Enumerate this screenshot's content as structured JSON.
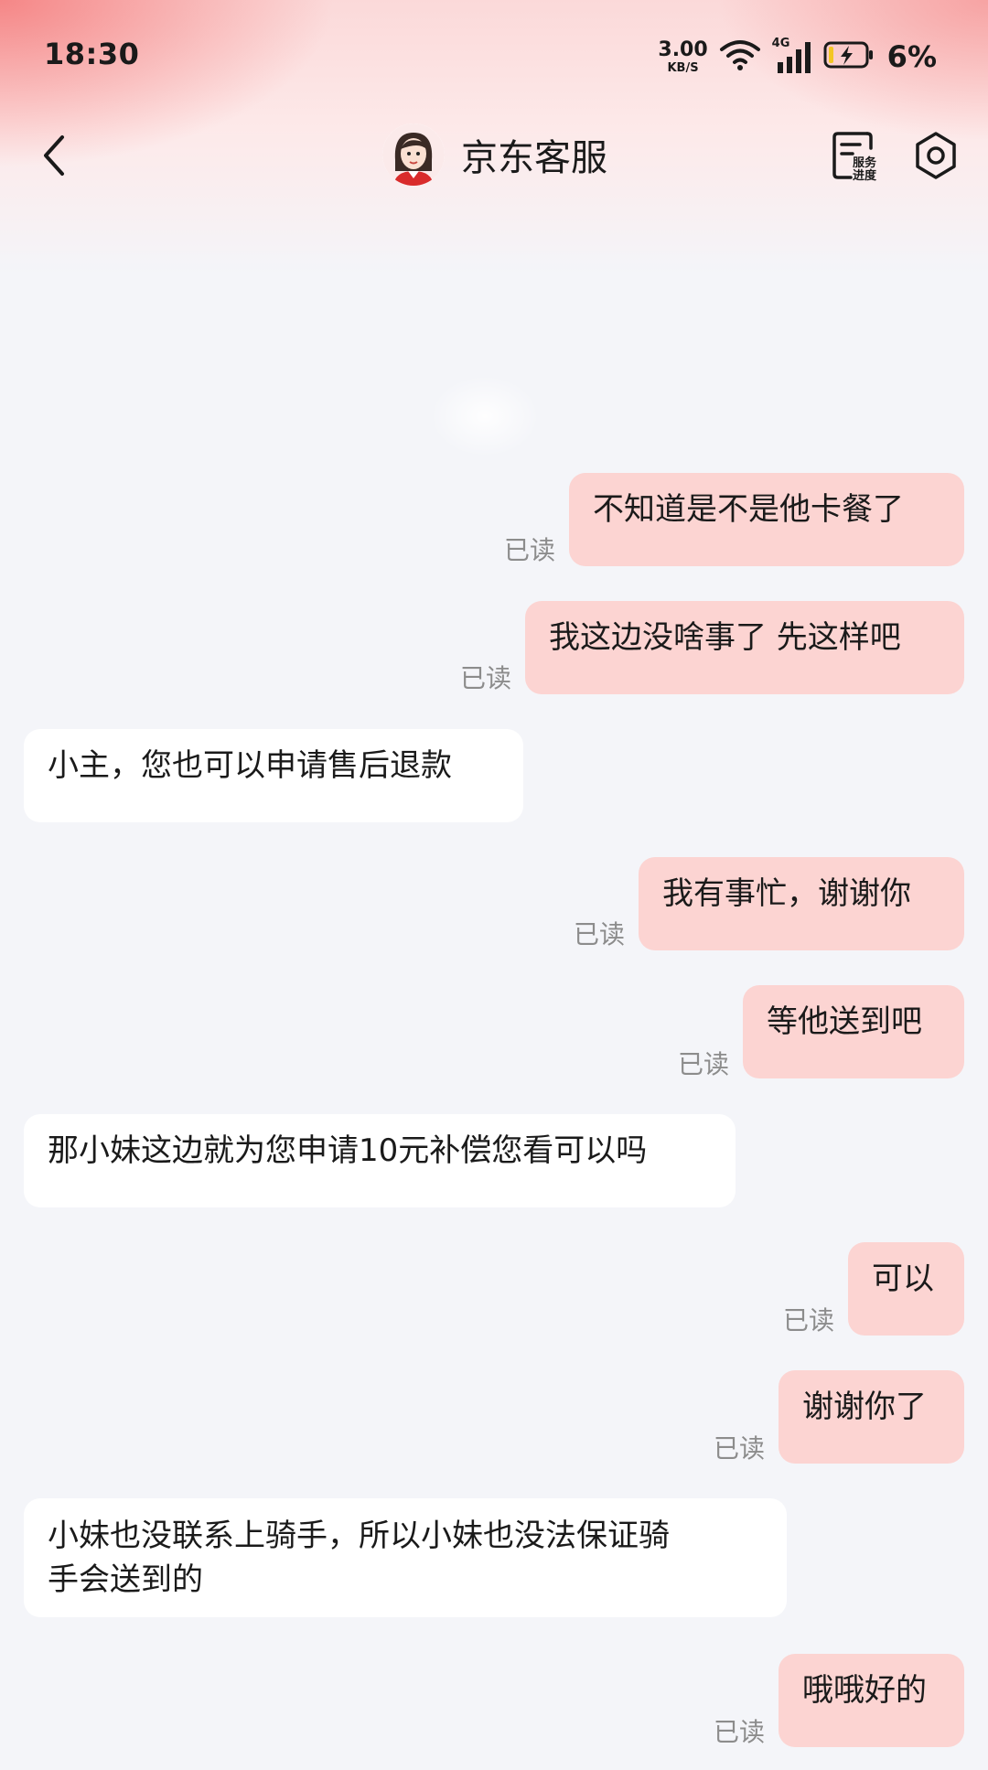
{
  "status_bar": {
    "time": "18:30",
    "net_speed_value": "3.00",
    "net_speed_unit": "KB/S",
    "network_type": "4G",
    "battery": "6%"
  },
  "header": {
    "title": "京东客服",
    "service_progress_label_1": "服务",
    "service_progress_label_2": "进度"
  },
  "messages": [
    {
      "side": "out",
      "text": "不知道是不是他卡餐了",
      "status": "已读"
    },
    {
      "side": "out",
      "text": "我这边没啥事了 先这样吧",
      "status": "已读"
    },
    {
      "side": "in",
      "text": "小主，您也可以申请售后退款"
    },
    {
      "side": "out",
      "text": "我有事忙，谢谢你",
      "status": "已读"
    },
    {
      "side": "out",
      "text": "等他送到吧",
      "status": "已读"
    },
    {
      "side": "in",
      "text": "那小妹这边就为您申请10元补偿您看可以吗"
    },
    {
      "side": "out",
      "text": "可以",
      "status": "已读"
    },
    {
      "side": "out",
      "text": "谢谢你了",
      "status": "已读"
    },
    {
      "side": "in",
      "text_line1": "小妹也没联系上骑手，所以小妹也没法保证骑",
      "text_line2": "手会送到的"
    },
    {
      "side": "out",
      "text": "哦哦好的",
      "status": "已读"
    }
  ],
  "colors": {
    "outgoing_bubble": "#fcd4d2",
    "incoming_bubble": "#ffffff",
    "background": "#f4f5f9",
    "read_status": "#8c8c8c"
  }
}
